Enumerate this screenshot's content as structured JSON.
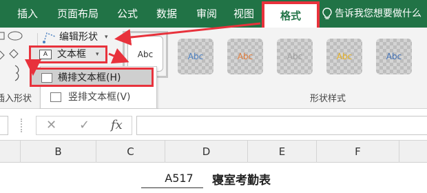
{
  "tabs": [
    {
      "key": "insert",
      "label": "插入"
    },
    {
      "key": "page_layout",
      "label": "页面布局"
    },
    {
      "key": "formulas",
      "label": "公式"
    },
    {
      "key": "data",
      "label": "数据"
    },
    {
      "key": "review",
      "label": "审阅"
    },
    {
      "key": "view",
      "label": "视图"
    }
  ],
  "active_tab": {
    "label": "格式"
  },
  "tell_me": "告诉我您想要做什么",
  "ribbon": {
    "edit_shape": "编辑形状",
    "textbox": "文本框",
    "insert_shapes_group": "插入形状",
    "shape_styles_group": "形状样式",
    "gallery": [
      {
        "label": "Abc",
        "color": "#333333"
      },
      {
        "label": "Abc",
        "color": "#4a7fc1"
      },
      {
        "label": "Abc",
        "color": "#e07b39"
      },
      {
        "label": "Abc",
        "color": "#9e9e9e"
      },
      {
        "label": "Abc",
        "color": "#e6b022"
      },
      {
        "label": "Abc",
        "color": "#3f6fb5"
      }
    ]
  },
  "dropdown": {
    "horizontal": "横排文本框(H)",
    "vertical": "竖排文本框(V)"
  },
  "formula_bar": {
    "cancel": "✕",
    "enter": "✓",
    "fx": "fx"
  },
  "columns": [
    "B",
    "C",
    "D",
    "E",
    "F"
  ],
  "sheet": {
    "cell_value": "A517",
    "title": "寝室考勤表"
  },
  "colors": {
    "ribbon_green": "#217346",
    "highlight_red": "#e8323c"
  }
}
